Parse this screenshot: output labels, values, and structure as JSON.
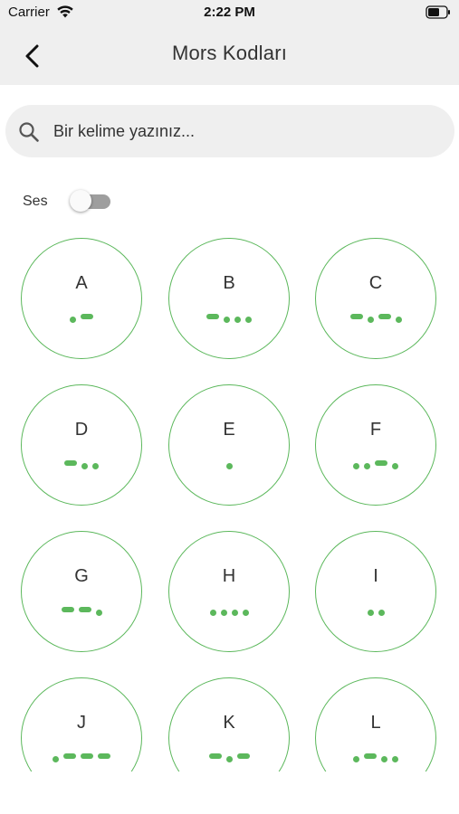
{
  "status_bar": {
    "carrier": "Carrier",
    "time": "2:22 PM",
    "icons": [
      "wifi-icon",
      "battery-icon"
    ]
  },
  "nav": {
    "title": "Mors Kodları",
    "back_icon": "chevron-left-icon"
  },
  "search": {
    "placeholder": "Bir kelime yazınız...",
    "value": "",
    "icon": "search-icon"
  },
  "sound": {
    "label": "Ses",
    "enabled": false
  },
  "colors": {
    "accent": "#5cb85c",
    "header_background": "#efefef",
    "toggle_off": "#9e9e9e"
  },
  "letters": [
    {
      "char": "A",
      "code": ".-"
    },
    {
      "char": "B",
      "code": "-..."
    },
    {
      "char": "C",
      "code": "-.-."
    },
    {
      "char": "D",
      "code": "-.."
    },
    {
      "char": "E",
      "code": "."
    },
    {
      "char": "F",
      "code": "..-."
    },
    {
      "char": "G",
      "code": "--."
    },
    {
      "char": "H",
      "code": "...."
    },
    {
      "char": "I",
      "code": ".."
    },
    {
      "char": "J",
      "code": ".---"
    },
    {
      "char": "K",
      "code": "-.-"
    },
    {
      "char": "L",
      "code": ".-.."
    }
  ]
}
